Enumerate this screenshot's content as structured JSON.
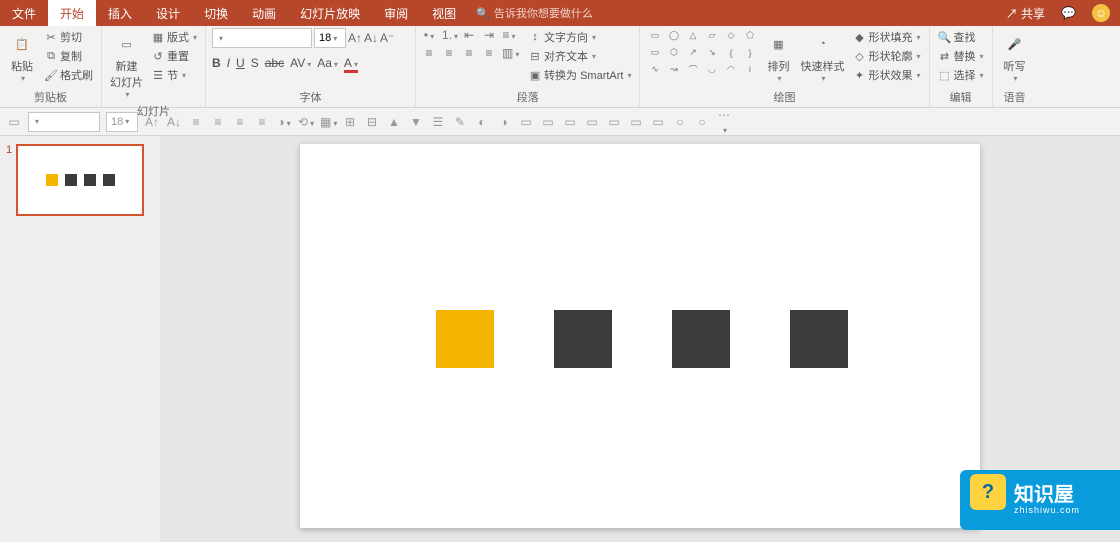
{
  "tabs": {
    "file": "文件",
    "home": "开始",
    "insert": "插入",
    "design": "设计",
    "transition": "切换",
    "animation": "动画",
    "slideshow": "幻灯片放映",
    "review": "审阅",
    "view": "视图"
  },
  "tellme": "告诉我你想要做什么",
  "share": "共享",
  "groups": {
    "clipboard": {
      "label": "剪贴板",
      "paste": "粘贴",
      "cut": "剪切",
      "copy": "复制",
      "painter": "格式刷"
    },
    "slides": {
      "label": "幻灯片",
      "new": "新建\n幻灯片",
      "layout": "版式",
      "reset": "重置",
      "section": "节"
    },
    "font": {
      "label": "字体",
      "size": "18"
    },
    "paragraph": {
      "label": "段落",
      "direction": "文字方向",
      "align": "对齐文本",
      "smartart": "转换为 SmartArt"
    },
    "drawing": {
      "label": "绘图",
      "arrange": "排列",
      "quick": "快速样式",
      "fill": "形状填充",
      "outline": "形状轮廓",
      "effects": "形状效果"
    },
    "editing": {
      "label": "编辑",
      "find": "查找",
      "replace": "替换",
      "select": "选择"
    },
    "voice": {
      "label": "语音",
      "dictate": "听写"
    }
  },
  "qat_size": "18",
  "thumb_num": "1",
  "watermark": {
    "title": "知识屋",
    "sub": "zhishiwu.com"
  }
}
